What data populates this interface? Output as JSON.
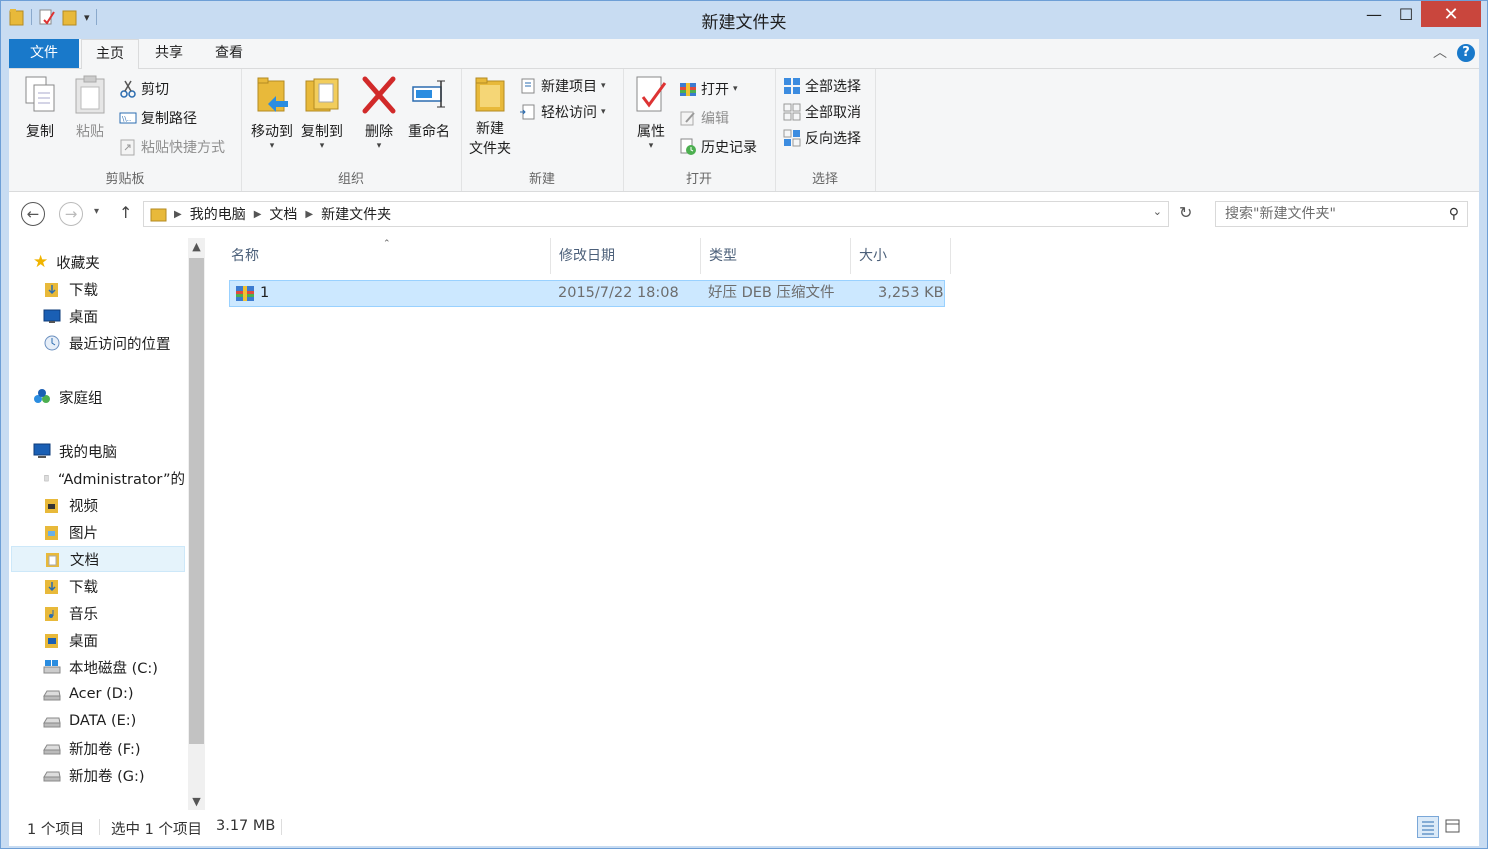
{
  "window": {
    "title": "新建文件夹",
    "close_symbol": "✕",
    "min_symbol": "—",
    "max_symbol": "☐"
  },
  "qat": {
    "dropdown_symbol": "▾"
  },
  "tabs": [
    {
      "label": "文件"
    },
    {
      "label": "主页"
    },
    {
      "label": "共享"
    },
    {
      "label": "查看"
    }
  ],
  "ribbon": {
    "clipboard": {
      "label": "剪贴板",
      "copy": "复制",
      "paste": "粘贴",
      "cut": "剪切",
      "copy_path": "复制路径",
      "paste_shortcut": "粘贴快捷方式"
    },
    "organize": {
      "label": "组织",
      "move_to": "移动到",
      "copy_to": "复制到",
      "delete": "删除",
      "rename": "重命名"
    },
    "new": {
      "label": "新建",
      "new_folder": "新建\n文件夹",
      "new_item": "新建项目",
      "easy_access": "轻松访问"
    },
    "open": {
      "label": "打开",
      "properties": "属性",
      "open": "打开",
      "edit": "编辑",
      "history": "历史记录"
    },
    "select": {
      "label": "选择",
      "select_all": "全部选择",
      "select_none": "全部取消",
      "invert": "反向选择"
    }
  },
  "address": {
    "crumbs": [
      "我的电脑",
      "文档",
      "新建文件夹"
    ],
    "search_placeholder": "搜索\"新建文件夹\""
  },
  "nav": {
    "favorites": "收藏夹",
    "fav_items": [
      "下载",
      "桌面",
      "最近访问的位置"
    ],
    "homegroup": "家庭组",
    "computer": "我的电脑",
    "computer_items": [
      "“Administrator”的",
      "视频",
      "图片",
      "文档",
      "下载",
      "音乐",
      "桌面",
      "本地磁盘 (C:)",
      "Acer (D:)",
      "DATA (E:)",
      "新加卷 (F:)",
      "新加卷 (G:)"
    ]
  },
  "columns": [
    "名称",
    "修改日期",
    "类型",
    "大小"
  ],
  "files": [
    {
      "name": "1",
      "modified": "2015/7/22 18:08",
      "type": "好压 DEB 压缩文件",
      "size": "3,253 KB"
    }
  ],
  "status": {
    "count": "1 个项目",
    "selected": "选中 1 个项目",
    "selected_size": "3.17 MB"
  },
  "colors": {
    "accent": "#1979ca",
    "selection": "#cce8ff",
    "close": "#c9463d"
  }
}
